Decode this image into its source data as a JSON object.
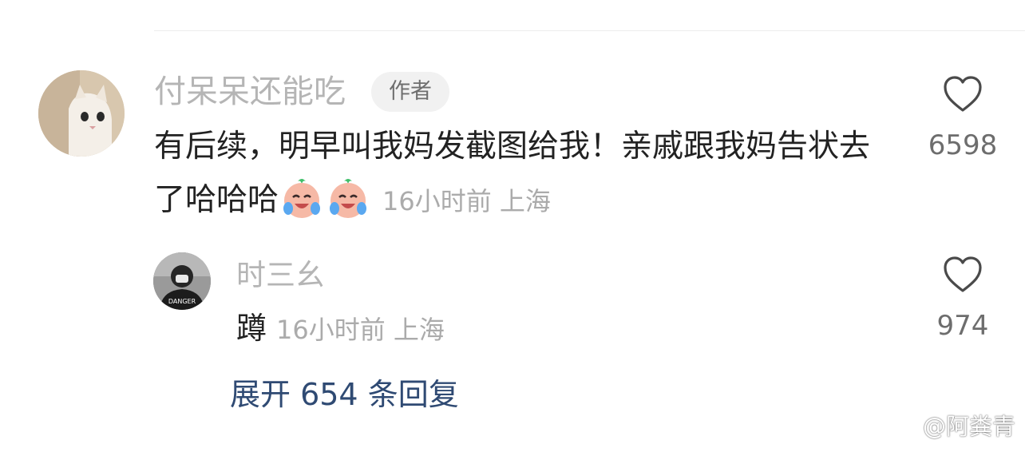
{
  "comment": {
    "username": "付呆呆还能吃",
    "badge": "作者",
    "text": "有后续，明早叫我妈发截图给我！亲戚跟我妈告状去了哈哈哈",
    "emojis": [
      "crying-laughing-emoji",
      "crying-laughing-emoji"
    ],
    "time": "16小时前",
    "location": "上海",
    "likes": "6598",
    "avatar": "cat-avatar"
  },
  "reply": {
    "username": "时三幺",
    "text": "蹲",
    "time": "16小时前",
    "location": "上海",
    "likes": "974",
    "avatar": "person-avatar"
  },
  "expand": {
    "label": "展开 654 条回复"
  },
  "watermark": {
    "text": "@阿粪青",
    "icon": "weibo-logo-icon"
  },
  "colors": {
    "muted": "#b5b5b5",
    "text": "#222222",
    "link": "#2f4a73",
    "badge_bg": "#f1f1f1"
  }
}
